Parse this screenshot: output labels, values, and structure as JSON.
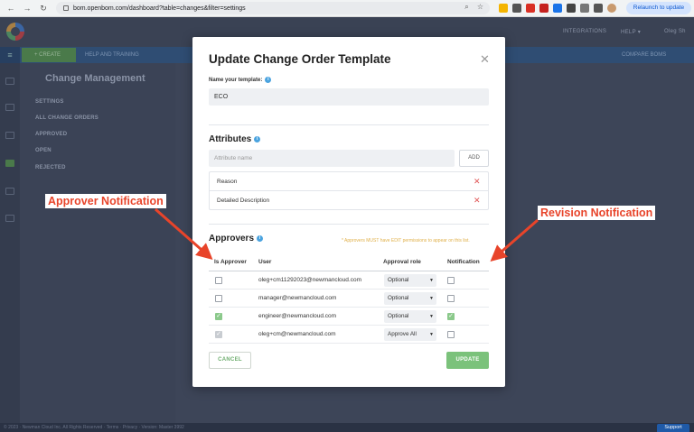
{
  "browser": {
    "url": "bom.openbom.com/dashboard?table=changes&filter=settings",
    "relaunch_label": "Relaunch to update"
  },
  "app": {
    "header_links": [
      "INTEGRATIONS",
      "HELP ▾",
      "Oleg Sh"
    ],
    "create_label": "+ CREATE",
    "help_label": "HELP AND TRAINING",
    "compare_label": "COMPARE BOMS",
    "panel_title": "Change Management",
    "panel_items": [
      "SETTINGS",
      "ALL CHANGE ORDERS",
      "APPROVED",
      "OPEN",
      "REJECTED"
    ],
    "footer_text": "© 2023 · Newman Cloud Inc. All Rights Reserved · Terms · Privacy · Version: Master 3992",
    "support_label": "Support"
  },
  "modal": {
    "title": "Update Change Order Template",
    "close_glyph": "✕",
    "name_label": "Name your template:",
    "template_name": "ECO",
    "attributes_title": "Attributes",
    "attribute_placeholder": "Attribute name",
    "add_label": "ADD",
    "attributes": [
      "Reason",
      "Detailed Description"
    ],
    "approvers_title": "Approvers",
    "approvers_note": "* Approvers MUST have EDIT permissions to appear on this list.",
    "columns": [
      "Is Approver",
      "User",
      "Approval role",
      "Notification"
    ],
    "rows": [
      {
        "user": "oleg+cm11292023@newmancloud.com",
        "role": "Optional",
        "approver": "unchecked",
        "notification": false
      },
      {
        "user": "manager@newmancloud.com",
        "role": "Optional",
        "approver": "unchecked",
        "notification": false
      },
      {
        "user": "engineer@newmancloud.com",
        "role": "Optional",
        "approver": "checked",
        "notification": true
      },
      {
        "user": "oleg+cm@newmancloud.com",
        "role": "Approve All",
        "approver": "disabled",
        "notification": false
      }
    ],
    "cancel_label": "CANCEL",
    "update_label": "UPDATE"
  },
  "annotations": {
    "approver": "Approver Notification",
    "revision": "Revision Notification",
    "color": "#e8442a"
  }
}
